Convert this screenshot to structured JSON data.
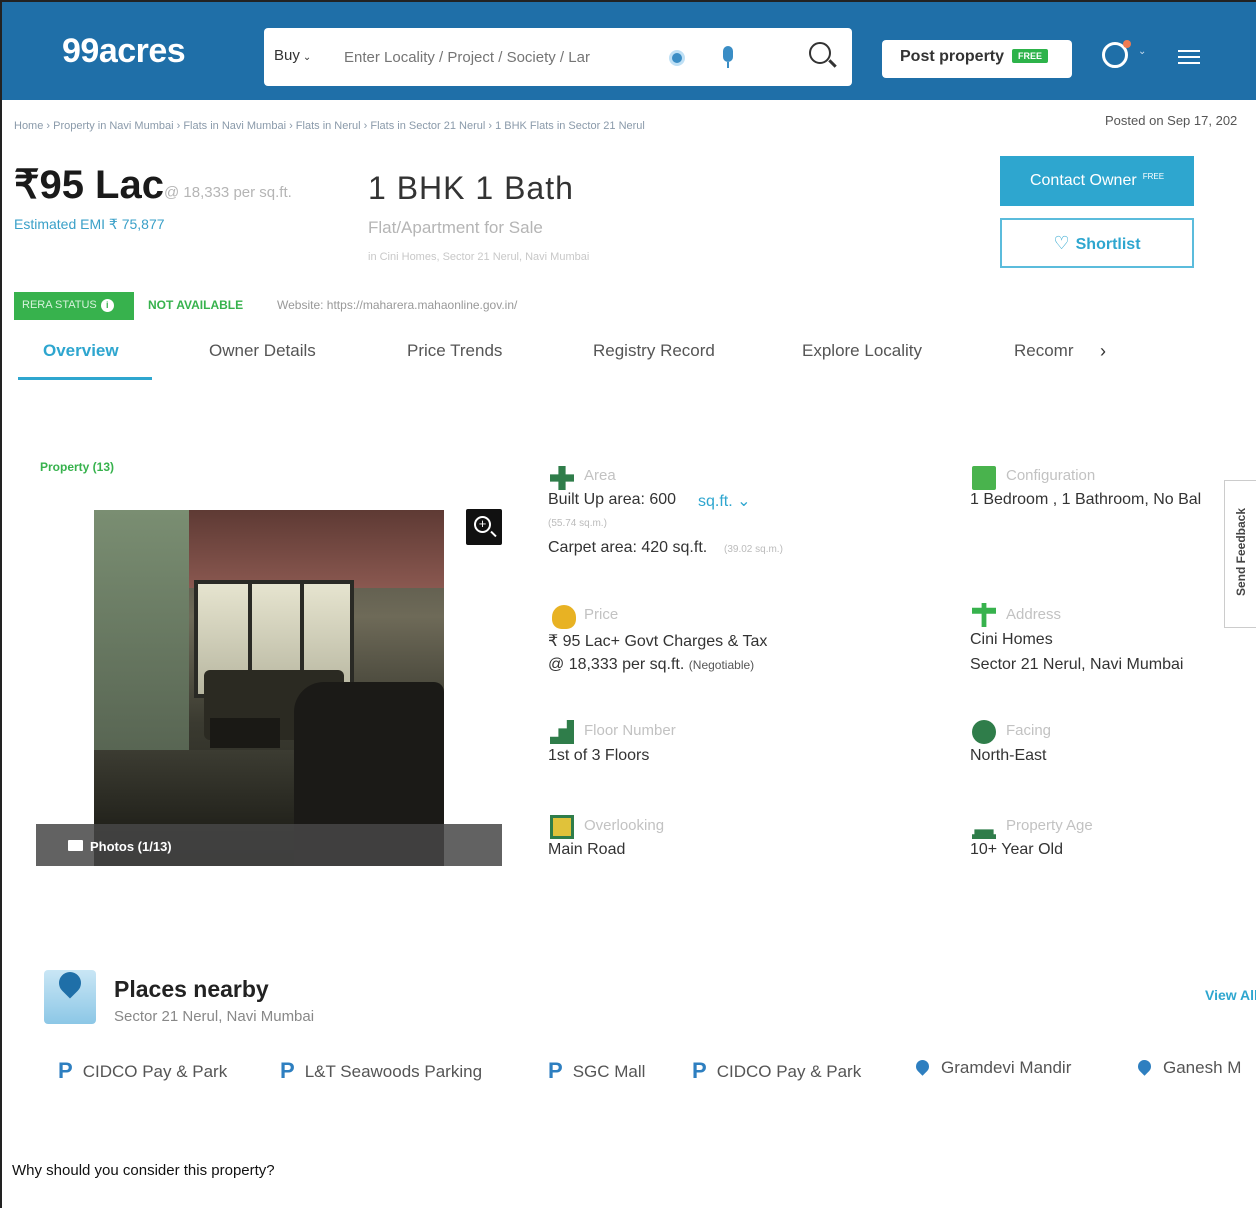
{
  "header": {
    "logo": "99acres",
    "search_type": "Buy",
    "search_placeholder": "Enter Locality / Project / Society / Lar",
    "post_label": "Post property",
    "post_badge": "FREE"
  },
  "breadcrumb": "Home › Property in Navi Mumbai › Flats in Navi Mumbai › Flats in Nerul › Flats in Sector 21 Nerul › 1 BHK Flats in Sector 21 Nerul",
  "posted": "Posted on Sep 17, 202",
  "listing": {
    "price": "₹95 Lac",
    "per_sqft": "@ 18,333 per sq.ft.",
    "emi": "Estimated EMI ₹ 75,877",
    "bhk": "1 BHK 1 Bath",
    "type": "Flat/Apartment for Sale",
    "location": "in Cini Homes, Sector 21 Nerul, Navi Mumbai",
    "contact_label": "Contact Owner",
    "contact_badge": "FREE",
    "shortlist_label": "Shortlist"
  },
  "rera": {
    "label": "RERA STATUS",
    "status": "NOT AVAILABLE",
    "website": "Website: https://maharera.mahaonline.gov.in/"
  },
  "tabs": [
    "Overview",
    "Owner Details",
    "Price Trends",
    "Registry Record",
    "Explore Locality",
    "Recomr"
  ],
  "property": {
    "label": "Property (13)",
    "photos": "Photos (1/13)"
  },
  "details": {
    "area_label": "Area",
    "area_value": "Built Up area: 600",
    "area_unit": "sq.ft. ⌄",
    "area_sqm": "(55.74 sq.m.)",
    "carpet_value": "Carpet area: 420 sq.ft.",
    "carpet_sqm": "(39.02 sq.m.)",
    "config_label": "Configuration",
    "config_value": "1 Bedroom , 1 Bathroom, No Bal",
    "price_label": "Price",
    "price_value": "₹ 95 Lac+ Govt Charges & Tax",
    "price_rate": "@ 18,333 per sq.ft.",
    "price_neg": "(Negotiable)",
    "address_label": "Address",
    "address_line1": "Cini Homes",
    "address_line2": "Sector 21 Nerul, Navi Mumbai",
    "floor_label": "Floor Number",
    "floor_value": "1st of 3 Floors",
    "facing_label": "Facing",
    "facing_value": "North-East",
    "overlooking_label": "Overlooking",
    "overlooking_value": "Main Road",
    "age_label": "Property Age",
    "age_value": "10+ Year Old"
  },
  "feedback": "Send Feedback",
  "nearby": {
    "title": "Places nearby",
    "subtitle": "Sector 21 Nerul, Navi Mumbai",
    "view_all": "View All",
    "places": [
      {
        "icon": "P",
        "name": "CIDCO Pay & Park"
      },
      {
        "icon": "P",
        "name": "L&T Seawoods Parking"
      },
      {
        "icon": "P",
        "name": "SGC Mall"
      },
      {
        "icon": "P",
        "name": "CIDCO Pay & Park"
      },
      {
        "icon": "pin",
        "name": "Gramdevi Mandir"
      },
      {
        "icon": "pin",
        "name": "Ganesh M"
      }
    ]
  },
  "why": "Why should you consider this property?"
}
